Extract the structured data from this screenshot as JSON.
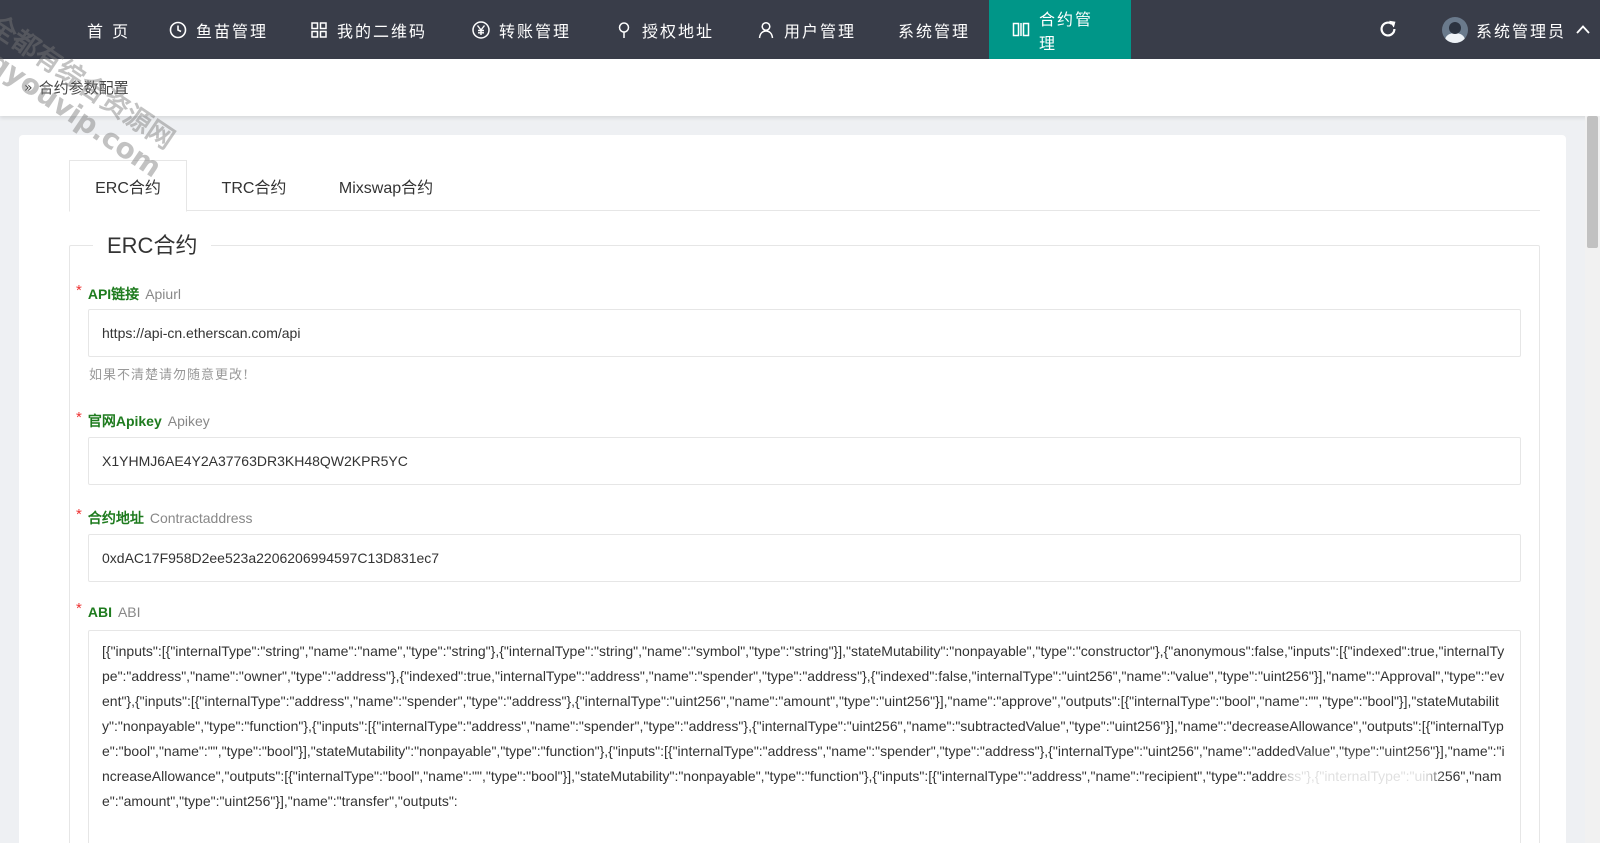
{
  "nav": {
    "items": [
      {
        "label": "首 页",
        "icon": "none"
      },
      {
        "label": "鱼苗管理",
        "icon": "clock-icon"
      },
      {
        "label": "我的二维码",
        "icon": "grid-icon"
      },
      {
        "label": "转账管理",
        "icon": "yen-icon"
      },
      {
        "label": "授权地址",
        "icon": "pin-icon"
      },
      {
        "label": "用户管理",
        "icon": "user-icon"
      },
      {
        "label": "系统管理",
        "icon": "none"
      },
      {
        "label": "合约管理",
        "icon": "columns-icon",
        "active": true
      }
    ],
    "user_name": "系统管理员",
    "active_color": "#009688",
    "bar_color": "#393d49"
  },
  "breadcrumb": {
    "label": "合约参数配置"
  },
  "tabs": [
    {
      "label": "ERC合约",
      "active": true
    },
    {
      "label": "TRC合约"
    },
    {
      "label": "Mixswap合约"
    }
  ],
  "section": {
    "legend": "ERC合约"
  },
  "fields": {
    "apiurl": {
      "label": "API链接",
      "sublabel": "Apiurl",
      "value": "https://api-cn.etherscan.com/api",
      "hint": "如果不清楚请勿随意更改!"
    },
    "apikey": {
      "label": "官网Apikey",
      "sublabel": "Apikey",
      "value": "X1YHMJ6AE4Y2A37763DR3KH48QW2KPR5YC"
    },
    "contract": {
      "label": "合约地址",
      "sublabel": "Contractaddress",
      "value": "0xdAC17F958D2ee523a2206206994597C13D831ec7"
    },
    "abi": {
      "label": "ABI",
      "sublabel": "ABI",
      "value": "[{\"inputs\":[{\"internalType\":\"string\",\"name\":\"name\",\"type\":\"string\"},{\"internalType\":\"string\",\"name\":\"symbol\",\"type\":\"string\"}],\"stateMutability\":\"nonpayable\",\"type\":\"constructor\"},{\"anonymous\":false,\"inputs\":[{\"indexed\":true,\"internalType\":\"address\",\"name\":\"owner\",\"type\":\"address\"},{\"indexed\":true,\"internalType\":\"address\",\"name\":\"spender\",\"type\":\"address\"},{\"indexed\":false,\"internalType\":\"uint256\",\"name\":\"value\",\"type\":\"uint256\"}],\"name\":\"Approval\",\"type\":\"event\"},{\"inputs\":[{\"internalType\":\"address\",\"name\":\"spender\",\"type\":\"address\"},{\"internalType\":\"uint256\",\"name\":\"amount\",\"type\":\"uint256\"}],\"name\":\"approve\",\"outputs\":[{\"internalType\":\"bool\",\"name\":\"\",\"type\":\"bool\"}],\"stateMutability\":\"nonpayable\",\"type\":\"function\"},{\"inputs\":[{\"internalType\":\"address\",\"name\":\"spender\",\"type\":\"address\"},{\"internalType\":\"uint256\",\"name\":\"subtractedValue\",\"type\":\"uint256\"}],\"name\":\"decreaseAllowance\",\"outputs\":[{\"internalType\":\"bool\",\"name\":\"\",\"type\":\"bool\"}],\"stateMutability\":\"nonpayable\",\"type\":\"function\"},{\"inputs\":[{\"internalType\":\"address\",\"name\":\"spender\",\"type\":\"address\"},{\"internalType\":\"uint256\",\"name\":\"addedValue\",\"type\":\"uint256\"}],\"name\":\"increaseAllowance\",\"outputs\":[{\"internalType\":\"bool\",\"name\":\"\",\"type\":\"bool\"}],\"stateMutability\":\"nonpayable\",\"type\":\"function\"},{\"inputs\":[{\"internalType\":\"address\",\"name\":\"recipient\",\"type\":\"address\"},{\"internalType\":\"uint256\",\"name\":\"amount\",\"type\":\"uint256\"}],\"name\":\"transfer\",\"outputs\":"
    }
  },
  "watermark": [
    "全都有综合资源网",
    "dqyouvip.com"
  ]
}
